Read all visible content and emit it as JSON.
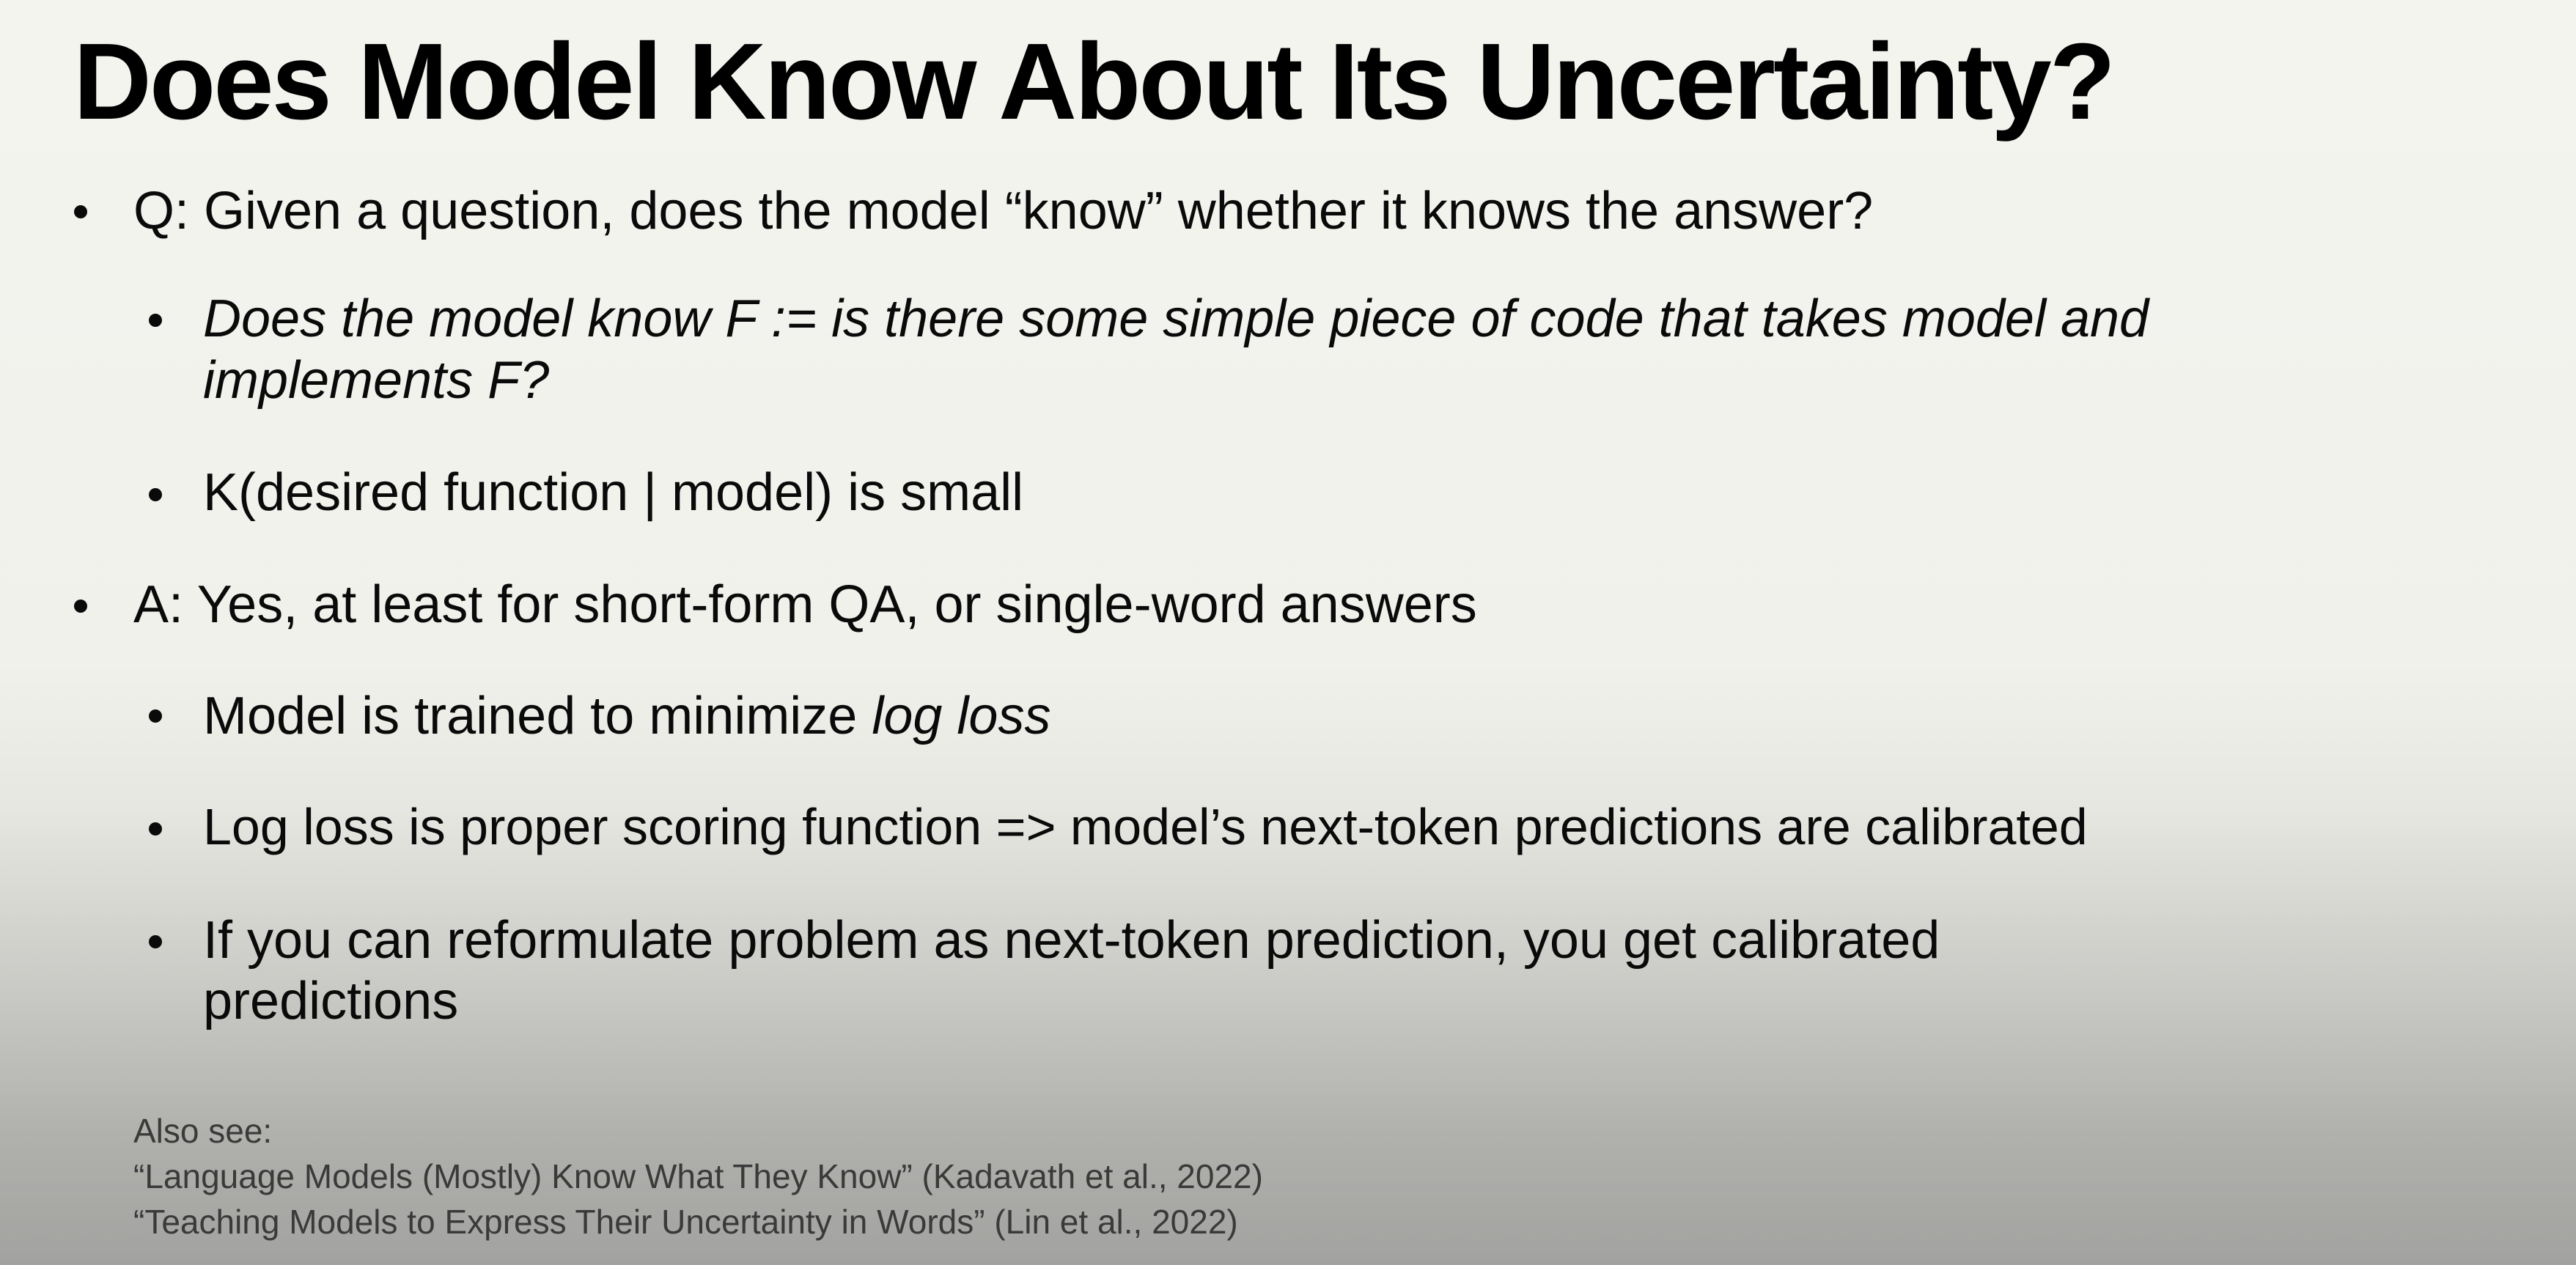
{
  "slide": {
    "title": "Does Model Know About Its Uncertainty?",
    "q": {
      "text": "Q: Given a question, does the model “know” whether it knows the answer?",
      "sub": [
        {
          "line1": "Does the model know F := is there some simple piece of code that takes model and",
          "line2": "implements F?"
        },
        {
          "line1": "K(desired function | model) is small"
        }
      ]
    },
    "a": {
      "text": "A: Yes, at least for short-form QA, or single-word answers",
      "sub": [
        {
          "prefix": "Model is trained to minimize ",
          "emph": "log loss"
        },
        {
          "line1": "Log loss is proper scoring function => model’s next-token predictions are calibrated"
        },
        {
          "line1": "If you can reformulate problem as next-token prediction, you get calibrated",
          "line2": "predictions"
        }
      ]
    },
    "refs": {
      "heading": "Also see:",
      "items": [
        "“Language Models (Mostly) Know What They Know” (Kadavath et al., 2022)",
        "“Teaching Models to Express Their Uncertainty in Words” (Lin et al., 2022)"
      ]
    }
  }
}
